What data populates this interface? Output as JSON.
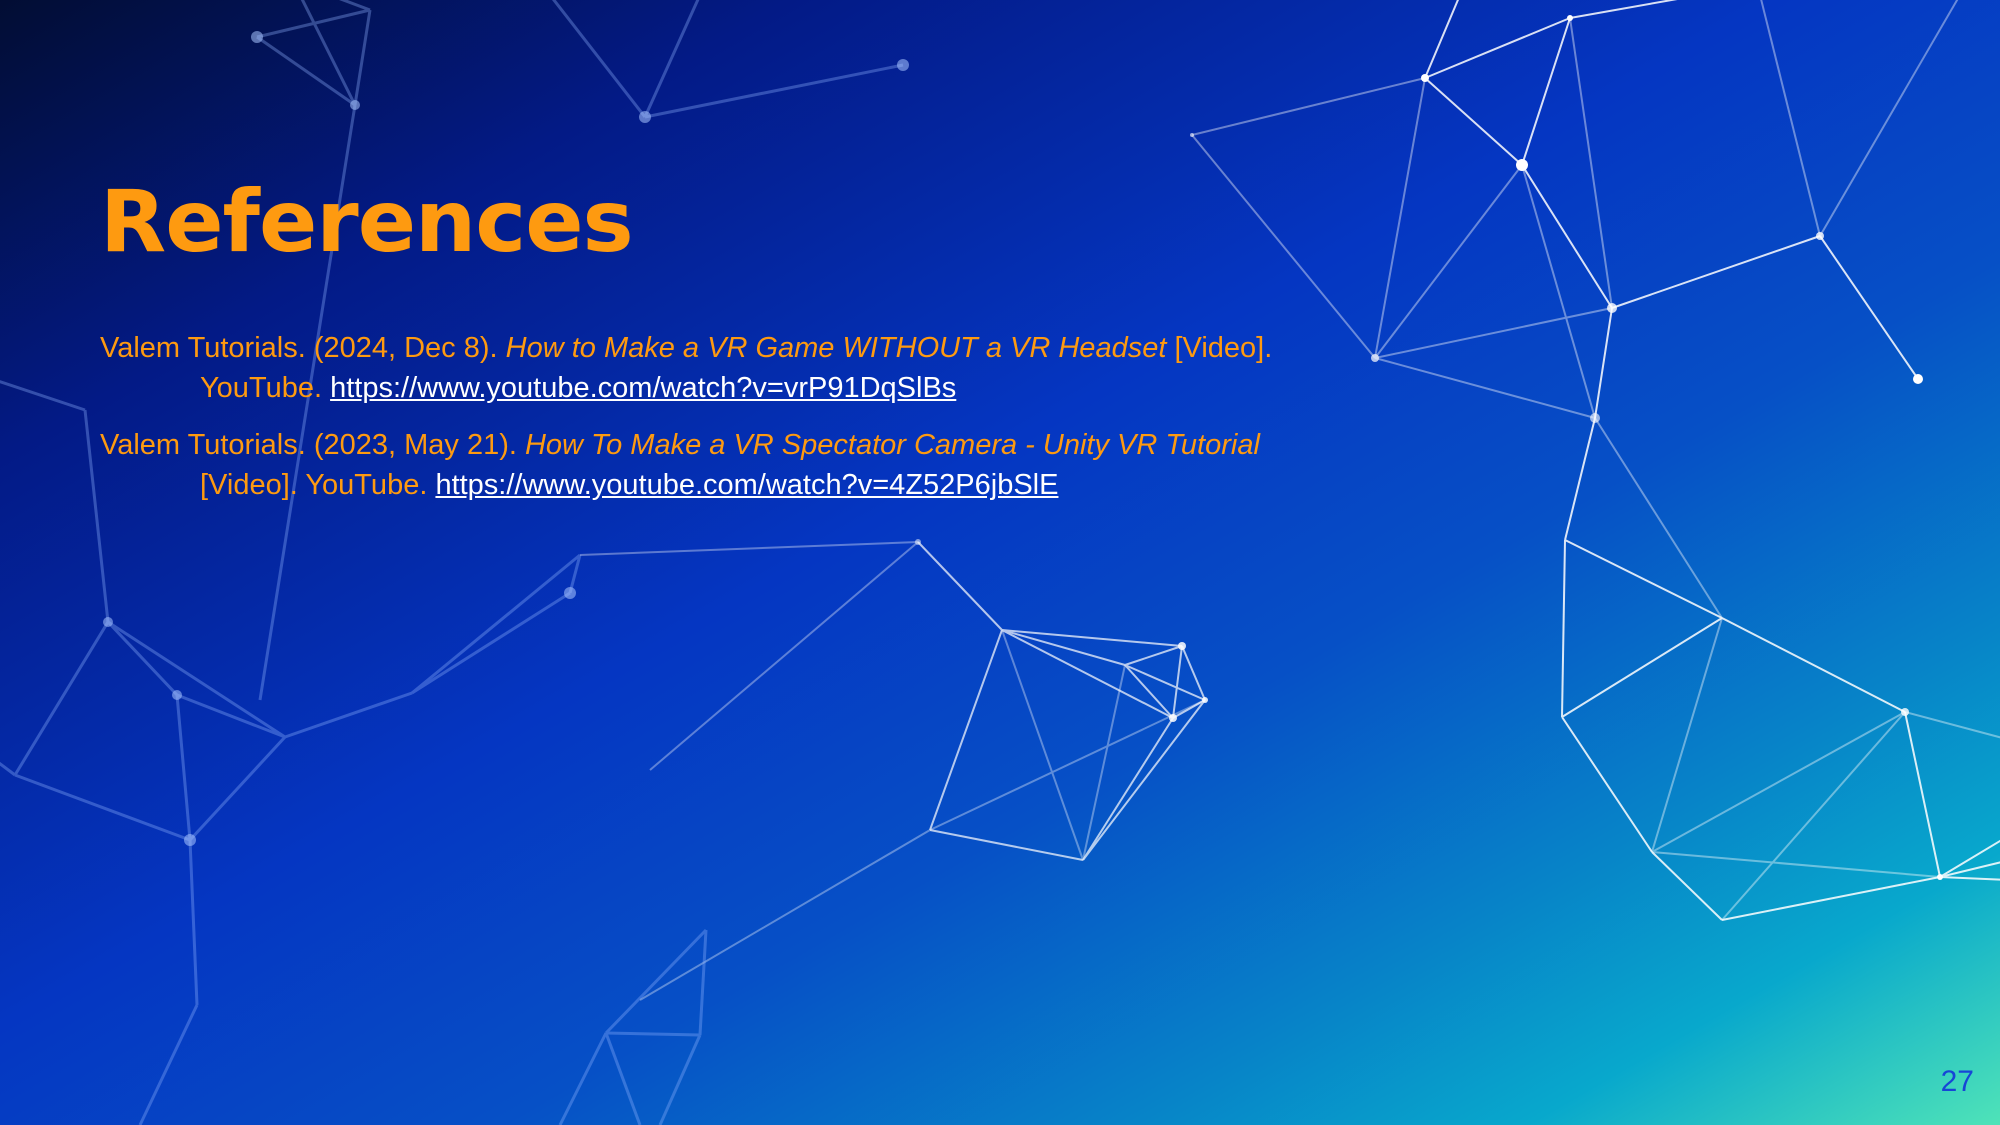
{
  "slide": {
    "title": "References",
    "page_number": "27"
  },
  "references": [
    {
      "authors": "Valem Tutorials.",
      "date": " (2024, Dec 8). ",
      "title": "How to Make a VR Game WITHOUT a VR Headset",
      "type": " [Video].",
      "publisher": " YouTube. ",
      "url": "https://www.youtube.com/watch?v=vrP91DqSlBs"
    },
    {
      "authors": "Valem Tutorials.",
      "date": " (2023, May 21). ",
      "title": "How To Make a VR Spectator Camera - Unity VR Tutorial",
      "type": " [Video].",
      "publisher": " YouTube. ",
      "url": "https://www.youtube.com/watch?v=4Z52P6jbSlE"
    }
  ],
  "colors": {
    "title": "#fe9a10",
    "body_text": "#fe9a10",
    "link": "#ffffff",
    "page_number": "#1746d6",
    "network_lines": "#ffffff"
  }
}
